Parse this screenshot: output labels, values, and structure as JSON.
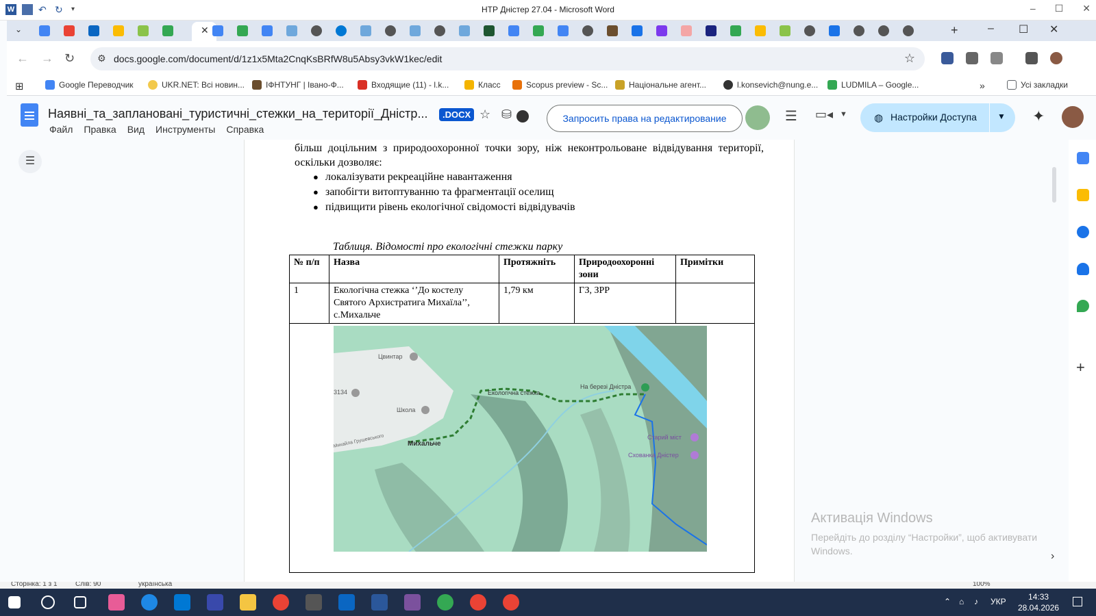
{
  "word": {
    "title": "НТР Дністер 27.04 - Microsoft Word",
    "controls": [
      "–",
      "☐",
      "✕"
    ]
  },
  "chrome": {
    "new_tab": "+",
    "window_controls": [
      "–",
      "☐",
      "✕"
    ],
    "url": "docs.google.com/document/d/1z1x5Mta2CnqKsBRfW8u5Absy3vkW1kec/edit"
  },
  "bookmarks": [
    {
      "label": "Google Переводчик",
      "color": "#4285f4"
    },
    {
      "label": "UKR.NET: Всі новин...",
      "color": "#f2c94c"
    },
    {
      "label": "ІФНТУНГ | Івано-Ф...",
      "color": "#6b4e2e"
    },
    {
      "label": "Входящие (11) - l.k...",
      "color": "#d93025"
    },
    {
      "label": "Класс",
      "color": "#f4b400"
    },
    {
      "label": "Scopus preview - Sc...",
      "color": "#e8710a"
    },
    {
      "label": "Національне агент...",
      "color": "#c9a227"
    },
    {
      "label": "l.konsevich@nung.e...",
      "color": "#333333"
    },
    {
      "label": "LUDMILA – Google...",
      "color": "#34a853"
    },
    {
      "label": "Усі закладки",
      "color": "#5f6368"
    }
  ],
  "docs": {
    "title": "Наявні_та_заплановані_туристичні_стежки_на_території_Дністр...",
    "badge": ".DOCX",
    "menu": [
      "Файл",
      "Правка",
      "Вид",
      "Инструменты",
      "Справка"
    ],
    "request_edit": "Запросить права на редактирование",
    "share_label": "Настройки Доступа"
  },
  "document": {
    "paragraph": "більш доцільним з природоохоронної точки зору, ніж неконтрольоване відвідування території, оскільки дозволяє:",
    "bullets": [
      "локалізувати рекреаційне навантаження",
      "запобігти витоптуванню та фрагментації оселищ",
      "підвищити рівень екологічної свідомості відвідувачів"
    ],
    "caption": "Таблиця. Відомості про екологічні стежки парку",
    "table": {
      "headers": [
        "№ п/п",
        "Назва",
        "Протяжніть",
        "Природоохоронні зони",
        "Примітки"
      ],
      "rows": [
        [
          "1",
          "Екологічна стежка ‘’До костелу Святого Архистратига Михаїла’’, с.Михальче",
          "1,79 км",
          "ГЗ, ЗРР",
          ""
        ]
      ]
    },
    "map_labels": {
      "tsvyntar": "Цвинтар",
      "n3134": "3134",
      "shkola": "Школа",
      "mykhalche": "Михальче",
      "street": "Михайла Грушевського",
      "trail": "Екологічна стежка",
      "bank": "На березі Дністра",
      "old_bridge": "Старий міст",
      "hideout": "Схованка Дністер"
    }
  },
  "activation": {
    "title": "Активація Windows",
    "text": "Перейдіть до розділу “Настройки”, щоб активувати Windows."
  },
  "status": {
    "page": "Сторінка: 1 з 1",
    "words": "Слів: 90",
    "lang": "українська",
    "zoom": "100%"
  },
  "taskbar": {
    "lang": "УКР",
    "time": "14:33",
    "date": "28.04.2026"
  }
}
